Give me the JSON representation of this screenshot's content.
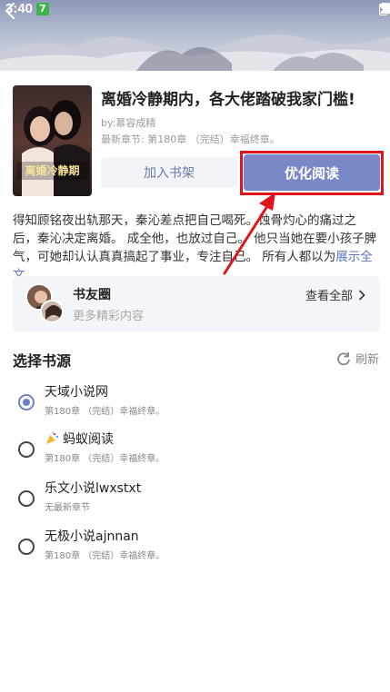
{
  "status_bar": {
    "time": "3:40",
    "app_badge": "7"
  },
  "book": {
    "title": "离婚冷静期内，各大佬踏破我家门槛!",
    "author": "by:慕容成精",
    "latest_chapter": "最新章节: 第180章 （完结）幸福终章。",
    "cover_title_text": "离婚冷静期"
  },
  "actions": {
    "add_shelf_label": "加入书架",
    "optimize_label": "优化阅读"
  },
  "description": {
    "text": "得知顾铭夜出轨那天，秦沁差点把自己喝死。蚀骨灼心的痛过之后，秦沁决定离婚。 成全他，也放过自己。 他只当她在要小孩子脾气，可她却认认真真搞起了事业，专注自己。 所有人都以为",
    "more_label": "展示全文"
  },
  "friends_circle": {
    "title": "书友圈",
    "subtitle": "更多精彩内容",
    "view_all_label": "查看全部"
  },
  "sources": {
    "title": "选择书源",
    "refresh_label": "刷新",
    "items": [
      {
        "name": "天域小说网",
        "chapter": "第180章 （完结）幸福终章。",
        "selected": true,
        "icon": ""
      },
      {
        "name": "蚂蚁阅读",
        "chapter": "第180章 （完结）幸福终章。",
        "selected": false,
        "icon": "party-popper-icon"
      },
      {
        "name": "乐文小说lwxstxt",
        "chapter": "无最新章节",
        "selected": false,
        "icon": ""
      },
      {
        "name": "无极小说ajnnan",
        "chapter": "第180章 （完结）幸福终章。",
        "selected": false,
        "icon": ""
      }
    ]
  },
  "colors": {
    "accent": "#7b88c7",
    "highlight_box": "#e0151c",
    "link": "#5b74c7"
  }
}
